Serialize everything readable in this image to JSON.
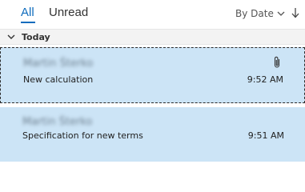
{
  "tabs": {
    "all_label": "All",
    "unread_label": "Unread"
  },
  "sort": {
    "label": "By Date",
    "chevron_icon": "chevron-down-icon",
    "direction_icon": "arrow-down-icon"
  },
  "group": {
    "label": "Today",
    "chevron_icon": "chevron-down-icon"
  },
  "colors": {
    "accent": "#0f6cbd",
    "selected_bg": "#cce4f6"
  },
  "messages": [
    {
      "sender": "Martin Šterko",
      "subject": "New calculation",
      "time": "9:52 AM",
      "has_attachment": true,
      "attachment_icon": "paperclip-icon"
    },
    {
      "sender": "Martin Šterko",
      "subject": "Specification for new terms",
      "time": "9:51 AM",
      "has_attachment": false
    }
  ]
}
